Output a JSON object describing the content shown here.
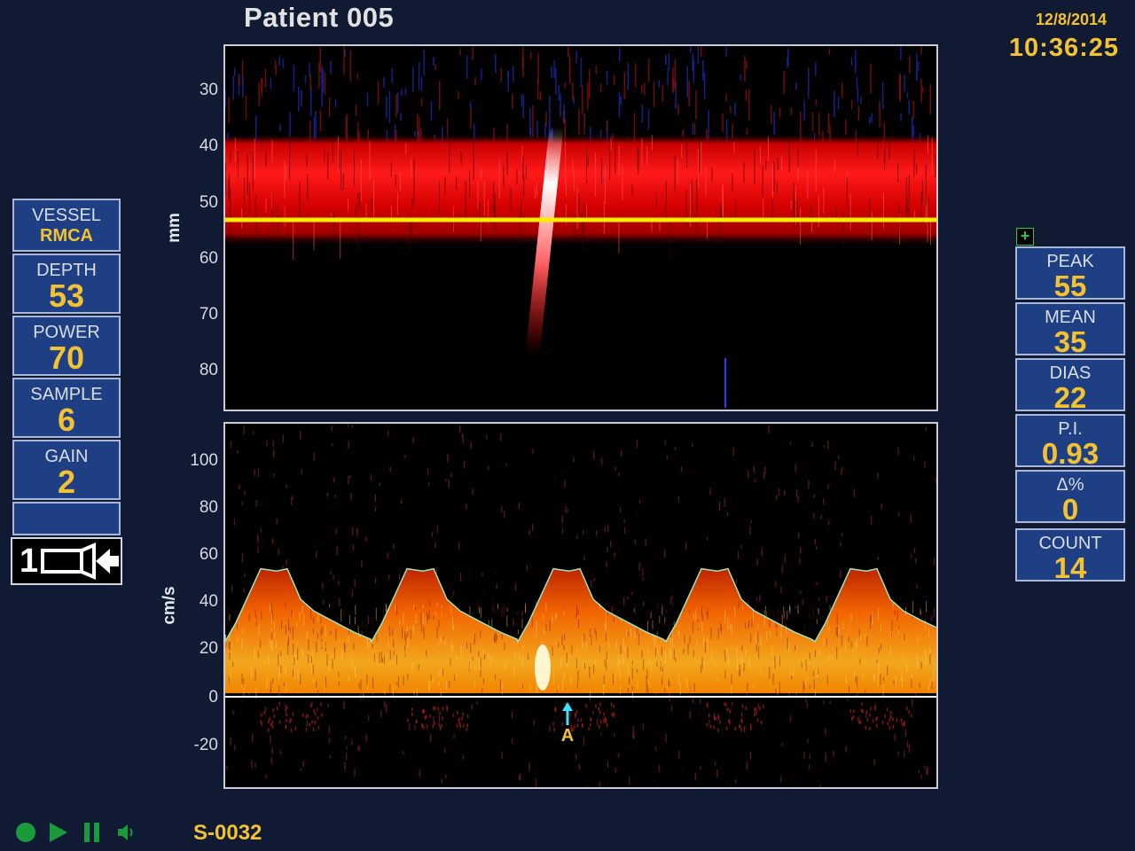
{
  "header": {
    "title": "Patient 005",
    "date": "12/8/2014",
    "time": "10:36:25"
  },
  "left_panel": [
    {
      "label": "VESSEL",
      "value": "RMCA",
      "small": true
    },
    {
      "label": "DEPTH",
      "value": "53"
    },
    {
      "label": "POWER",
      "value": "70"
    },
    {
      "label": "SAMPLE",
      "value": "6"
    },
    {
      "label": "GAIN",
      "value": "2"
    },
    {
      "label": "",
      "value": ""
    }
  ],
  "probe_indicator": "1",
  "right_panel": [
    {
      "label": "PEAK",
      "value": "55"
    },
    {
      "label": "MEAN",
      "value": "35"
    },
    {
      "label": "DIAS",
      "value": "22"
    },
    {
      "label": "P.I.",
      "value": "0.93"
    },
    {
      "label": "Δ%",
      "value": "0"
    },
    {
      "label": "COUNT",
      "value": "14"
    }
  ],
  "add_button_label": "+",
  "mmode": {
    "ylabel": "mm",
    "ticks": [
      "30",
      "40",
      "50",
      "60",
      "70",
      "80"
    ],
    "gate_depth": 53
  },
  "spectrum": {
    "ylabel": "cm/s",
    "ticks": [
      "100",
      "80",
      "60",
      "40",
      "20",
      "0",
      "-20"
    ],
    "marker_label": "A"
  },
  "footer": {
    "sample_id": "S-0032"
  },
  "colors": {
    "accent": "#f2c230",
    "panel": "#1f3f84",
    "background": "#111a33",
    "gate": "#ffee00",
    "envelope": "#9fe3c0"
  },
  "icons": [
    "record-icon",
    "play-icon",
    "pause-icon",
    "speaker-icon",
    "probe-icon",
    "plus-icon"
  ]
}
